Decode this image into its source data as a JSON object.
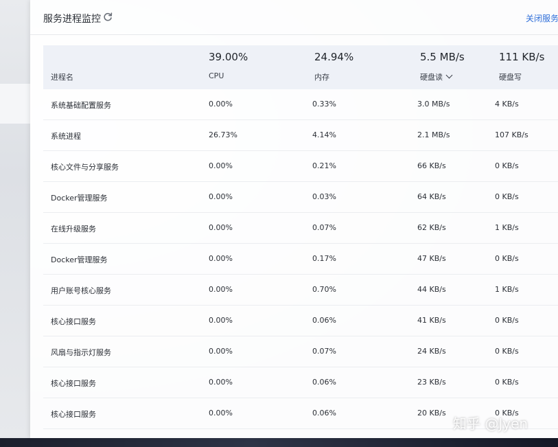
{
  "panel": {
    "title": "服务进程监控",
    "close_label": "关闭服务"
  },
  "summary": {
    "cpu": {
      "value": "39.00%",
      "label": "CPU"
    },
    "memory": {
      "value": "24.94%",
      "label": "内存"
    },
    "disk_read": {
      "value": "5.5 MB/s",
      "label": "硬盘读"
    },
    "disk_write": {
      "value": "111 KB/s",
      "label": "硬盘写"
    }
  },
  "table": {
    "process_header": "进程名",
    "rows": [
      {
        "name": "系统基础配置服务",
        "cpu": "0.00%",
        "memory": "0.33%",
        "disk_read": "3.0 MB/s",
        "disk_write": "4 KB/s"
      },
      {
        "name": "系统进程",
        "cpu": "26.73%",
        "memory": "4.14%",
        "disk_read": "2.1 MB/s",
        "disk_write": "107 KB/s"
      },
      {
        "name": "核心文件与分享服务",
        "cpu": "0.00%",
        "memory": "0.21%",
        "disk_read": "66 KB/s",
        "disk_write": "0 KB/s"
      },
      {
        "name": "Docker管理服务",
        "cpu": "0.00%",
        "memory": "0.03%",
        "disk_read": "64 KB/s",
        "disk_write": "0 KB/s"
      },
      {
        "name": "在线升级服务",
        "cpu": "0.00%",
        "memory": "0.07%",
        "disk_read": "62 KB/s",
        "disk_write": "1 KB/s"
      },
      {
        "name": "Docker管理服务",
        "cpu": "0.00%",
        "memory": "0.17%",
        "disk_read": "47 KB/s",
        "disk_write": "0 KB/s"
      },
      {
        "name": "用户账号核心服务",
        "cpu": "0.00%",
        "memory": "0.70%",
        "disk_read": "44 KB/s",
        "disk_write": "1 KB/s"
      },
      {
        "name": "核心接口服务",
        "cpu": "0.00%",
        "memory": "0.06%",
        "disk_read": "41 KB/s",
        "disk_write": "0 KB/s"
      },
      {
        "name": "风扇与指示灯服务",
        "cpu": "0.00%",
        "memory": "0.07%",
        "disk_read": "24 KB/s",
        "disk_write": "0 KB/s"
      },
      {
        "name": "核心接口服务",
        "cpu": "0.00%",
        "memory": "0.06%",
        "disk_read": "23 KB/s",
        "disk_write": "0 KB/s"
      },
      {
        "name": "核心接口服务",
        "cpu": "0.00%",
        "memory": "0.06%",
        "disk_read": "20 KB/s",
        "disk_write": "0 KB/s"
      }
    ]
  },
  "watermark": "知乎 @Jyen",
  "icons": {
    "refresh": "refresh-icon",
    "sort": "chevron-down-icon"
  },
  "colors": {
    "accent": "#2f6fd9",
    "header_bg": "#eef1f7"
  }
}
